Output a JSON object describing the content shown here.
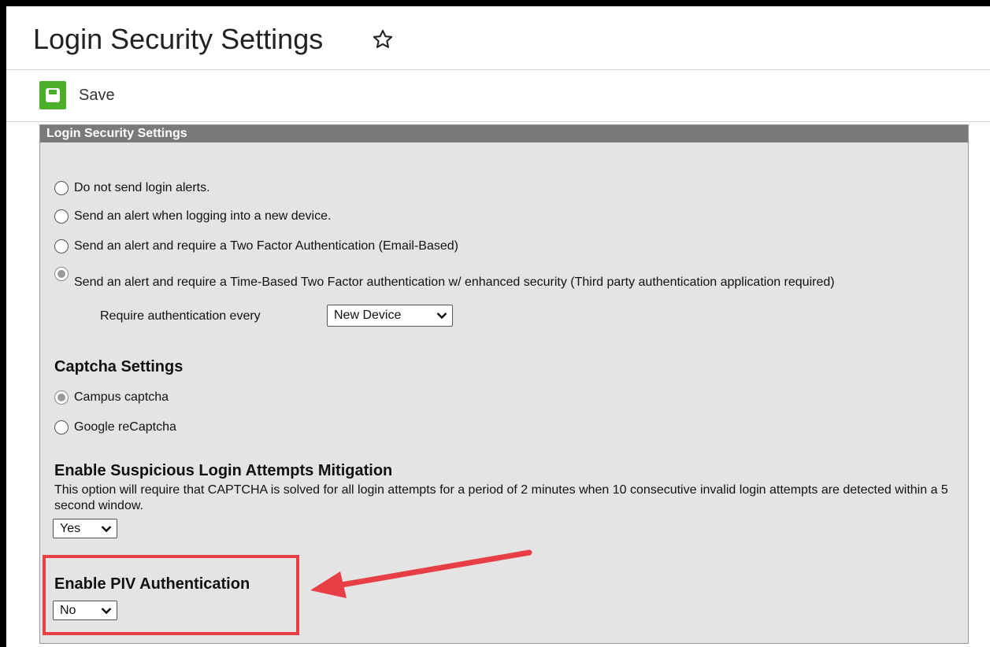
{
  "header": {
    "title": "Login Security Settings",
    "favorite_icon": "star-outline-icon"
  },
  "toolbar": {
    "save_label": "Save",
    "save_icon": "floppy-disk-icon",
    "save_color": "#4caf2a"
  },
  "panel": {
    "title": "Login Security Settings",
    "login_alerts": {
      "options": [
        {
          "label": "Do not send login alerts.",
          "checked": false
        },
        {
          "label": "Send an alert when logging into a new device.",
          "checked": false
        },
        {
          "label": "Send an alert and require a Two Factor Authentication (Email-Based)",
          "checked": false
        },
        {
          "label": "Send an alert and require a Time-Based Two Factor authentication w/ enhanced security (Third party authentication application required)",
          "checked": true
        }
      ],
      "require_label": "Require authentication every",
      "require_value": "New Device"
    },
    "captcha": {
      "title": "Captcha Settings",
      "options": [
        {
          "label": "Campus captcha",
          "checked": true
        },
        {
          "label": "Google reCaptcha",
          "checked": false
        }
      ]
    },
    "suspicious": {
      "title": "Enable Suspicious Login Attempts Mitigation",
      "description": "This option will require that CAPTCHA is solved for all login attempts for a period of 2 minutes when 10 consecutive invalid login attempts are detected within a 5 second window.",
      "value": "Yes"
    },
    "piv": {
      "title": "Enable PIV Authentication",
      "value": "No"
    }
  },
  "annotation": {
    "color": "#e83e45"
  }
}
